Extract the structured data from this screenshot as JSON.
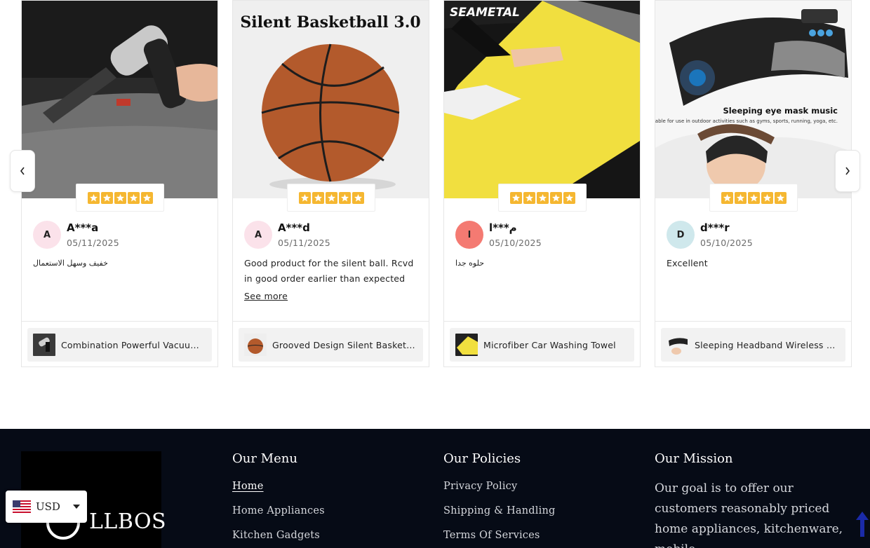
{
  "reviews": [
    {
      "initial": "A",
      "avatar_color": "#fbe2ea",
      "name": "A***a",
      "date": "05/11/2025",
      "text": "خفيف وسهل الاستعمال",
      "rtl": true,
      "see_more": "",
      "product": "Combination Powerful Vacuum ...",
      "photo": "vacuum",
      "rating": 5
    },
    {
      "initial": "A",
      "avatar_color": "#fbe2ea",
      "name": "A***d",
      "date": "05/11/2025",
      "text": "Good product for the silent ball. Rcvd in good order earlier than expected",
      "rtl": false,
      "see_more": "See more",
      "product": "Grooved Design Silent Basketball",
      "photo": "basketball",
      "photo_caption": "Silent Basketball 3.0",
      "rating": 5
    },
    {
      "initial": "ا",
      "avatar_color": "#f47a72",
      "name": "م***ا",
      "date": "05/10/2025",
      "text": "حلوه جدا",
      "rtl": true,
      "see_more": "",
      "product": "Microfiber Car Washing Towel",
      "photo": "towel",
      "photo_caption": "SEAMETAL",
      "rating": 5
    },
    {
      "initial": "D",
      "avatar_color": "#cfe8ec",
      "name": "d***r",
      "date": "05/10/2025",
      "text": "Excellent",
      "rtl": false,
      "see_more": "",
      "product": "Sleeping Headband Wireless M...",
      "photo": "headband",
      "photo_caption": "Sleeping eye mask music",
      "photo_subcaption": "Suitable for use in outdoor activities such as gyms, sports, running, yoga, etc.",
      "rating": 5
    }
  ],
  "carousel": {
    "prev_icon": "chevron-left-icon",
    "next_icon": "chevron-right-icon"
  },
  "footer": {
    "logo_text": "LLBOS",
    "menu_title": "Our Menu",
    "menu_items": [
      "Home",
      "Home Appliances",
      "Kitchen Gadgets"
    ],
    "policies_title": "Our Policies",
    "policies_items": [
      "Privacy Policy",
      "Shipping & Handling",
      "Terms Of Services"
    ],
    "mission_title": "Our Mission",
    "mission_text": "Our goal is to offer our customers reasonably priced home appliances, kitchenware, mobile"
  },
  "currency": {
    "code": "USD",
    "flag": "us-flag-icon"
  },
  "colors": {
    "star": "#f5b731",
    "footer_bg": "#060b16",
    "scroll_top": "#1a2aa8"
  }
}
